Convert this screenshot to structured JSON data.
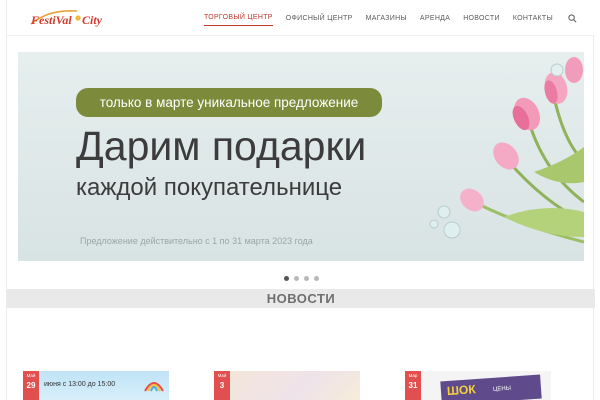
{
  "header": {
    "logo_text": "FestiVal City",
    "nav": [
      {
        "label": "ТОРГОВЫЙ ЦЕНТР",
        "active": true
      },
      {
        "label": "ОФИСНЫЙ ЦЕНТР",
        "active": false
      },
      {
        "label": "МАГАЗИНЫ",
        "active": false
      },
      {
        "label": "АРЕНДА",
        "active": false
      },
      {
        "label": "НОВОСТИ",
        "active": false
      },
      {
        "label": "КОНТАКТЫ",
        "active": false
      }
    ],
    "search_icon": "search-icon"
  },
  "banner": {
    "pill_text": "только в марте уникальное предложение",
    "headline": "Дарим подарки",
    "subline": "каждой покупательнице",
    "note": "Предложение действительно с 1 по 31 марта 2023 года",
    "colors": {
      "pill": "#7c8b3b",
      "background": "#e2eaea"
    }
  },
  "carousel": {
    "dots": 4,
    "active": 0
  },
  "news": {
    "title": "НОВОСТИ",
    "cards": [
      {
        "month": "Май",
        "day": "29",
        "text": "июня с 13:00 до 15:00"
      },
      {
        "month": "Май",
        "day": "3",
        "text": ""
      },
      {
        "month": "Мар",
        "day": "31",
        "sign_big": "ШОК",
        "sign_small": "ЦЕНЫ"
      }
    ]
  },
  "colors": {
    "accent": "#c0392b",
    "badge": "#e24f4f"
  }
}
